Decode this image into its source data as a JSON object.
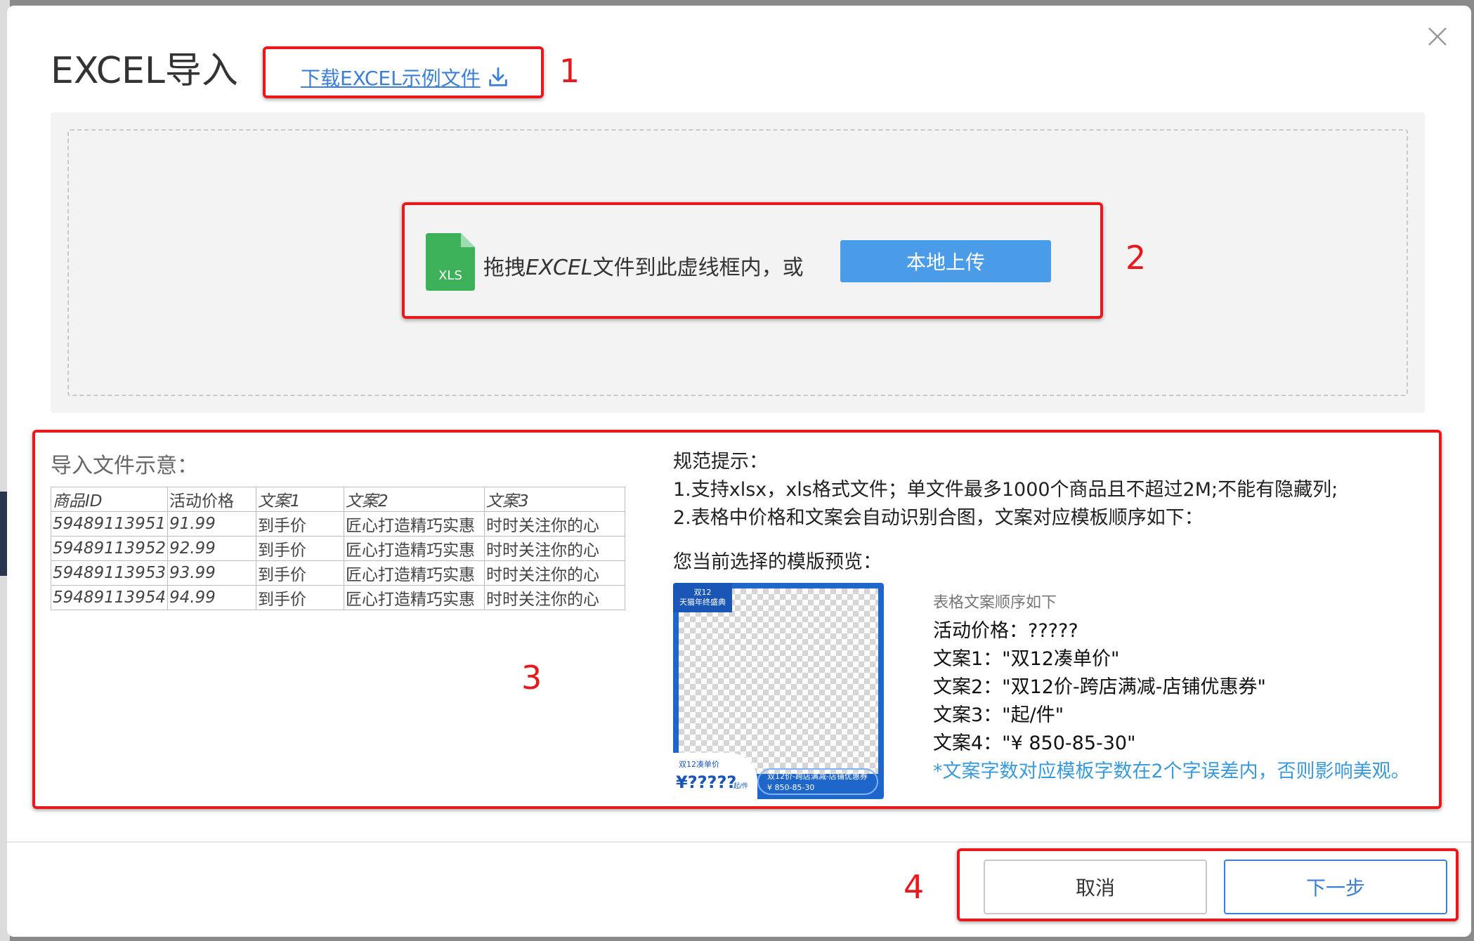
{
  "dialog": {
    "title": "EXCEL导入",
    "download_link": "下载EXCEL示例文件",
    "close_icon": "close-icon"
  },
  "upload": {
    "file_icon_label": "XLS",
    "drag_text_prefix": "拖拽",
    "drag_text_emph": "EXCEL",
    "drag_text_suffix": "文件到此虚线框内，或",
    "button_label": "本地上传"
  },
  "sample": {
    "title": "导入文件示意：",
    "headers": [
      "商品ID",
      "活动价格",
      "文案1",
      "文案2",
      "文案3"
    ],
    "rows": [
      [
        "59489113951",
        "91.99",
        "到手价",
        "匠心打造精巧实惠",
        "时时关注你的心"
      ],
      [
        "59489113952",
        "92.99",
        "到手价",
        "匠心打造精巧实惠",
        "时时关注你的心"
      ],
      [
        "59489113953",
        "93.99",
        "到手价",
        "匠心打造精巧实惠",
        "时时关注你的心"
      ],
      [
        "59489113954",
        "94.99",
        "到手价",
        "匠心打造精巧实惠",
        "时时关注你的心"
      ]
    ]
  },
  "rules": {
    "title": "规范提示：",
    "line1": "1.支持xlsx，xls格式文件；单文件最多1000个商品且不超过2M;不能有隐藏列;",
    "line2": "2.表格中价格和文案会自动识别合图，文案对应模板顺序如下：",
    "preview_label": "您当前选择的模版预览："
  },
  "template": {
    "badge_line1": "双12",
    "badge_line2": "天猫年终盛典",
    "price_label": "双12凑单价",
    "price": "¥?????",
    "unit": "起/件",
    "coupon_line1": "双12价-跨店满减-店铺优惠券",
    "coupon_line2": "¥ 850-85-30"
  },
  "order": {
    "header": "表格文案顺序如下",
    "lines": [
      "活动价格：?????",
      "文案1：\"双12凑单价\"",
      "文案2：\"双12价-跨店满减-店铺优惠券\"",
      "文案3：\"起/件\"",
      "文案4：\"¥ 850-85-30\""
    ],
    "warning": "*文案字数对应模板字数在2个字误差内，否则影响美观。"
  },
  "footer": {
    "cancel_label": "取消",
    "next_label": "下一步"
  },
  "annotations": [
    "1",
    "2",
    "3",
    "4"
  ],
  "colors": {
    "annotation": "#e8191d",
    "primary": "#4a9be8",
    "link": "#3b7fd6",
    "warning_text": "#3a9ad9",
    "xls_green": "#3cb15a"
  }
}
